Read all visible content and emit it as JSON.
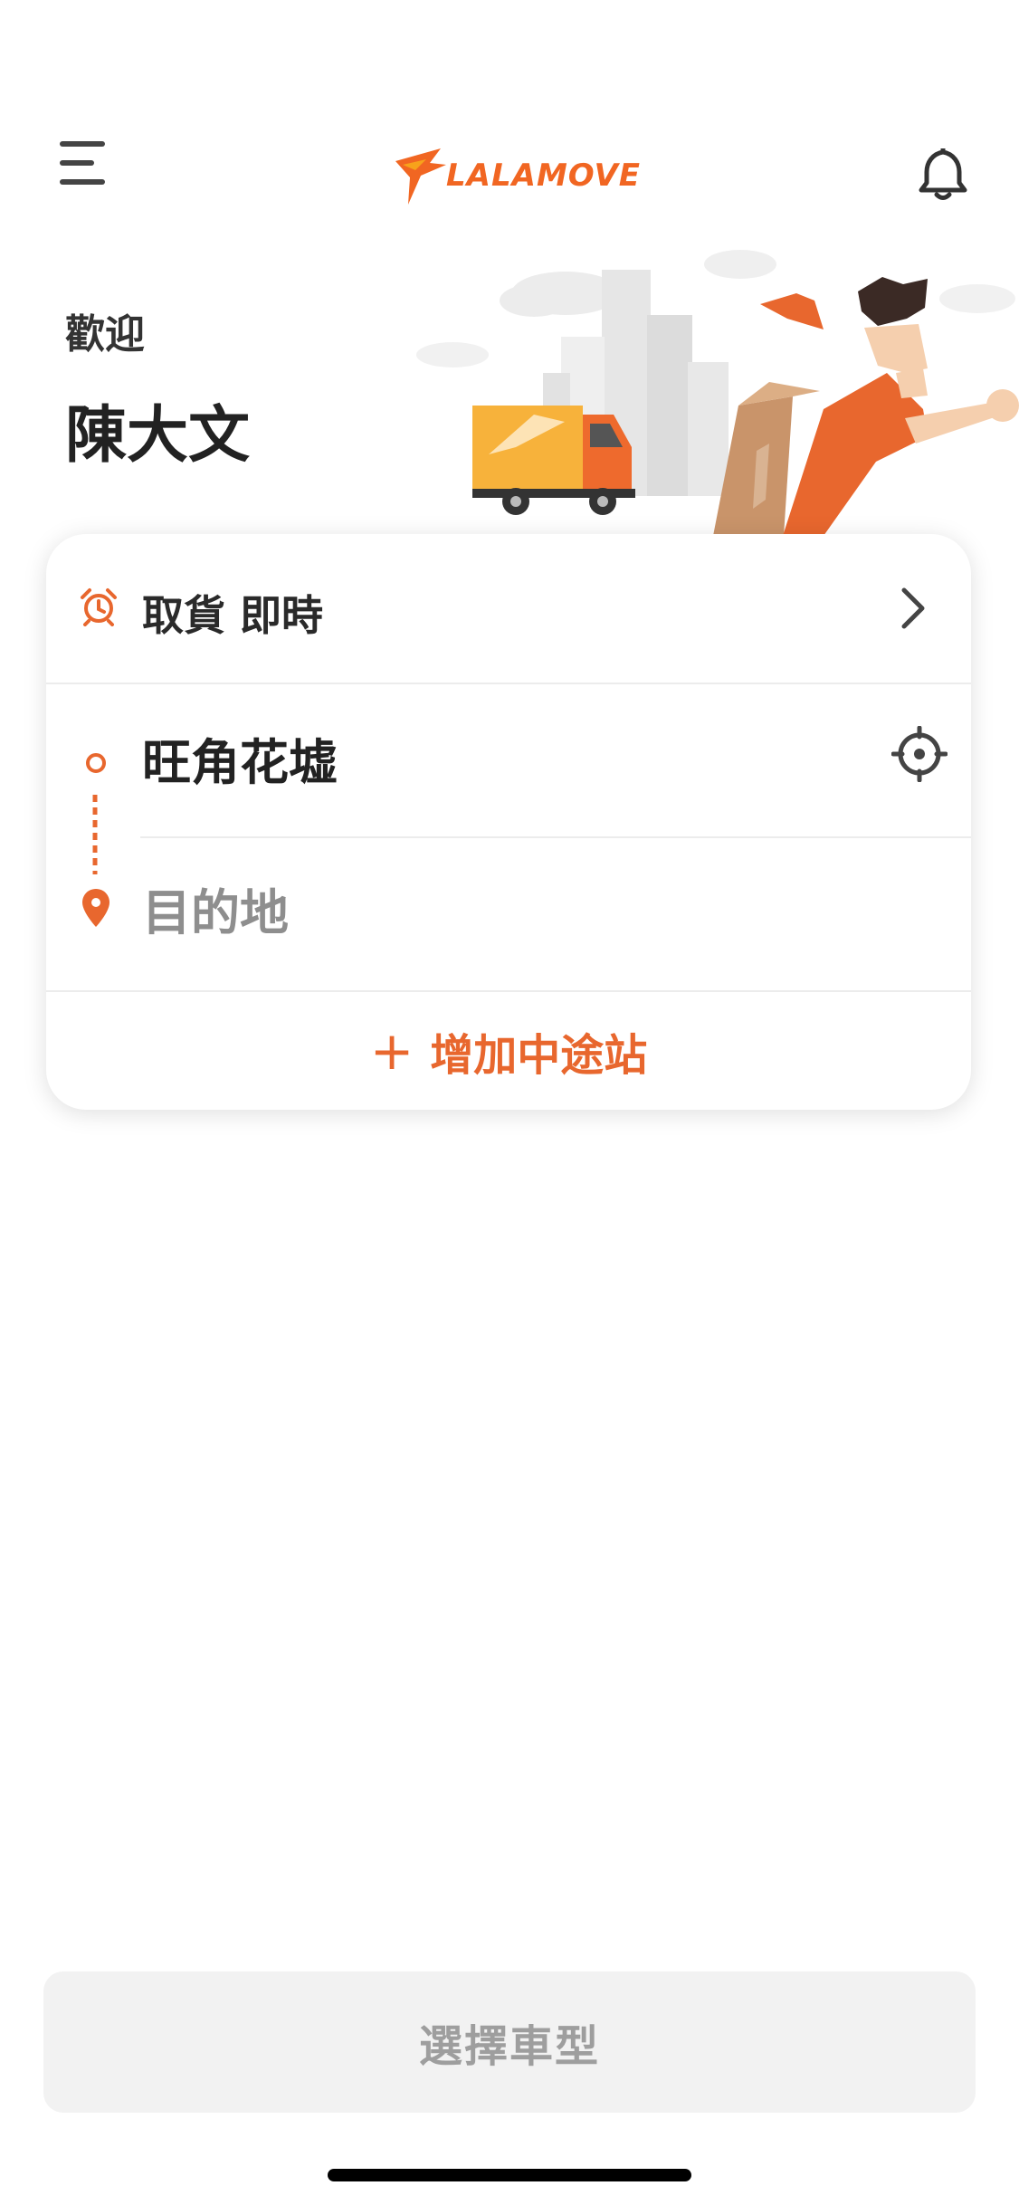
{
  "header": {
    "logo_text": "LALAMOVE",
    "menu_icon": "hamburger-menu-icon",
    "notification_icon": "bell-icon"
  },
  "greeting": {
    "welcome": "歡迎",
    "user_name": "陳大文"
  },
  "order_card": {
    "pickup_time": {
      "label": "取貨 即時",
      "icon": "alarm-clock-icon"
    },
    "stops": {
      "pickup": "旺角花墟",
      "destination_placeholder": "目的地"
    },
    "add_stop": {
      "plus": "+",
      "label": "增加中途站"
    }
  },
  "footer": {
    "select_vehicle_label": "選擇車型"
  },
  "colors": {
    "accent": "#e8672e",
    "text_dark": "#222222",
    "placeholder": "#8e8e8e",
    "disabled_button_bg": "#f2f2f2",
    "disabled_button_text": "#9e9e9e"
  }
}
